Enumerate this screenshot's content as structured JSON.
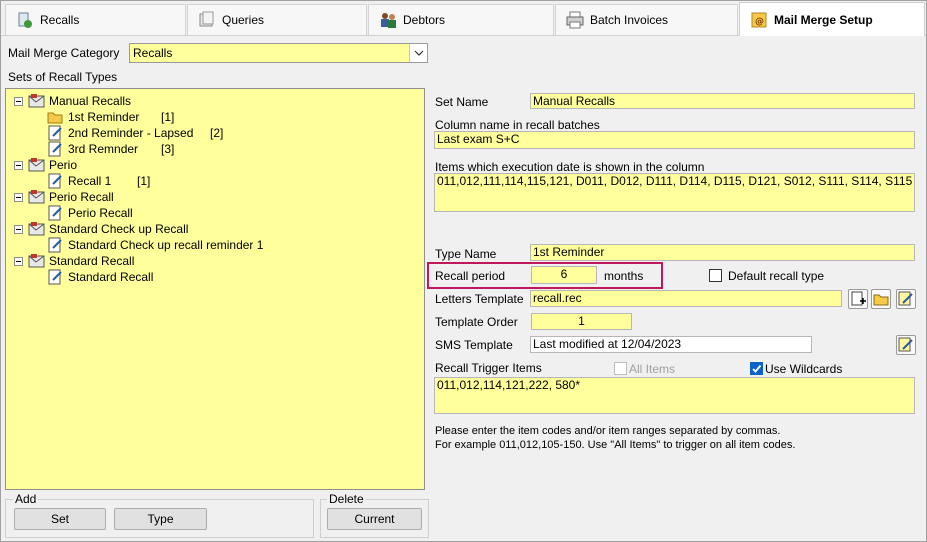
{
  "tabs": [
    {
      "label": "Recalls",
      "icon": "recall-icon"
    },
    {
      "label": "Queries",
      "icon": "query-icon"
    },
    {
      "label": "Debtors",
      "icon": "debtors-icon"
    },
    {
      "label": "Batch Invoices",
      "icon": "printer-icon"
    },
    {
      "label": "Mail Merge Setup",
      "icon": "mail-merge-icon",
      "active": true
    }
  ],
  "category": {
    "label": "Mail Merge Category",
    "value": "Recalls"
  },
  "sets_label": "Sets of Recall Types",
  "tree": [
    {
      "label": "Manual Recalls",
      "type": "set"
    },
    {
      "label": "1st Reminder",
      "count": "[1]",
      "type": "item",
      "selected": true
    },
    {
      "label": "2nd Reminder - Lapsed",
      "count": "[2]",
      "type": "item"
    },
    {
      "label": "3rd Remnder",
      "count": "[3]",
      "type": "item"
    },
    {
      "label": "Perio",
      "type": "set"
    },
    {
      "label": "Recall 1",
      "count": "[1]",
      "type": "item"
    },
    {
      "label": "Perio Recall",
      "type": "set"
    },
    {
      "label": "Perio Recall",
      "type": "item"
    },
    {
      "label": "Standard Check up Recall",
      "type": "set"
    },
    {
      "label": "Standard Check up recall reminder 1",
      "type": "item"
    },
    {
      "label": "Standard Recall",
      "type": "set"
    },
    {
      "label": "Standard Recall",
      "type": "item"
    }
  ],
  "add_group": {
    "label": "Add",
    "set_button": "Set",
    "type_button": "Type"
  },
  "delete_group": {
    "label": "Delete",
    "current_button": "Current"
  },
  "form": {
    "set_name_label": "Set Name",
    "set_name": "Manual Recalls",
    "column_name_label": "Column name in recall batches",
    "column_name": "Last exam S+C",
    "items_label": "Items which execution date is shown in the column",
    "items": "011,012,111,114,115,121, D011, D012, D111, D114, D115, D121, S012, S111, S114, S115",
    "type_name_label": "Type Name",
    "type_name": "1st Reminder",
    "recall_period_label": "Recall period",
    "recall_period": "6",
    "recall_period_unit": "months",
    "default_recall_label": "Default recall type",
    "default_recall_checked": false,
    "letters_template_label": "Letters Template",
    "letters_template": "recall.rec",
    "template_order_label": "Template Order",
    "template_order": "1",
    "sms_template_label": "SMS Template",
    "sms_template": "Last modified at 12/04/2023",
    "trigger_label": "Recall Trigger Items",
    "all_items_label": "All Items",
    "all_items_checked": false,
    "wildcards_label": "Use Wildcards",
    "wildcards_checked": true,
    "trigger_items": "011,012,114,121,222, 580*",
    "hint_line1": "Please enter the item codes and/or item ranges separated by commas.",
    "hint_line2": "For example 011,012,105-150. Use \"All Items\" to trigger on all item codes."
  },
  "colors": {
    "field_yellow": "#ffff9c",
    "highlight": "#c2185b",
    "checkbox_on": "#0a64c8"
  }
}
